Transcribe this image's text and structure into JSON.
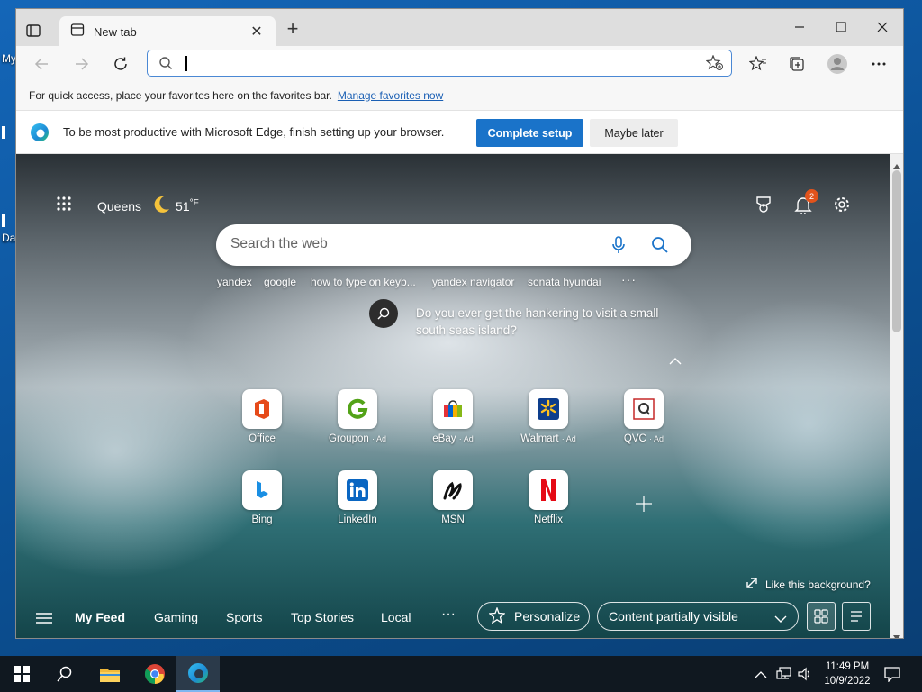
{
  "desktop": {
    "icon_labels": [
      "My",
      "Da"
    ]
  },
  "browser": {
    "tab": {
      "title": "New tab",
      "icon": "newtab-page-icon"
    },
    "address_bar": {
      "value": "",
      "icon": "search-icon"
    },
    "favorites_bar": {
      "text": "For quick access, place your favorites here on the favorites bar.",
      "link": "Manage favorites now"
    },
    "setup_banner": {
      "text": "To be most productive with Microsoft Edge, finish setting up your browser.",
      "primary_button": "Complete setup",
      "secondary_button": "Maybe later"
    }
  },
  "ntp": {
    "weather": {
      "location": "Queens",
      "temperature": "51",
      "unit": "°F"
    },
    "notification_count": "2",
    "search": {
      "placeholder": "Search the web"
    },
    "quick_searches": [
      "yandex",
      "google",
      "how to type on keyb...",
      "yandex navigator",
      "sonata hyundai"
    ],
    "image_info": "Do you ever get the hankering to visit a small south seas island?",
    "tiles": [
      {
        "label": "Office",
        "ad": ""
      },
      {
        "label": "Groupon",
        "ad": "· Ad"
      },
      {
        "label": "eBay",
        "ad": "· Ad"
      },
      {
        "label": "Walmart",
        "ad": "· Ad"
      },
      {
        "label": "QVC",
        "ad": "· Ad"
      },
      {
        "label": "Bing",
        "ad": ""
      },
      {
        "label": "LinkedIn",
        "ad": ""
      },
      {
        "label": "MSN",
        "ad": ""
      },
      {
        "label": "Netflix",
        "ad": ""
      }
    ],
    "like_background": "Like this background?",
    "feed": {
      "items": [
        "My Feed",
        "Gaming",
        "Sports",
        "Top Stories",
        "Local"
      ],
      "personalize": "Personalize",
      "content_visibility": "Content partially visible"
    }
  },
  "taskbar": {
    "time": "11:49 PM",
    "date": "10/9/2022"
  },
  "colors": {
    "accent": "#1a73c9",
    "badge": "#e2531b",
    "taskbar": "#101820"
  }
}
